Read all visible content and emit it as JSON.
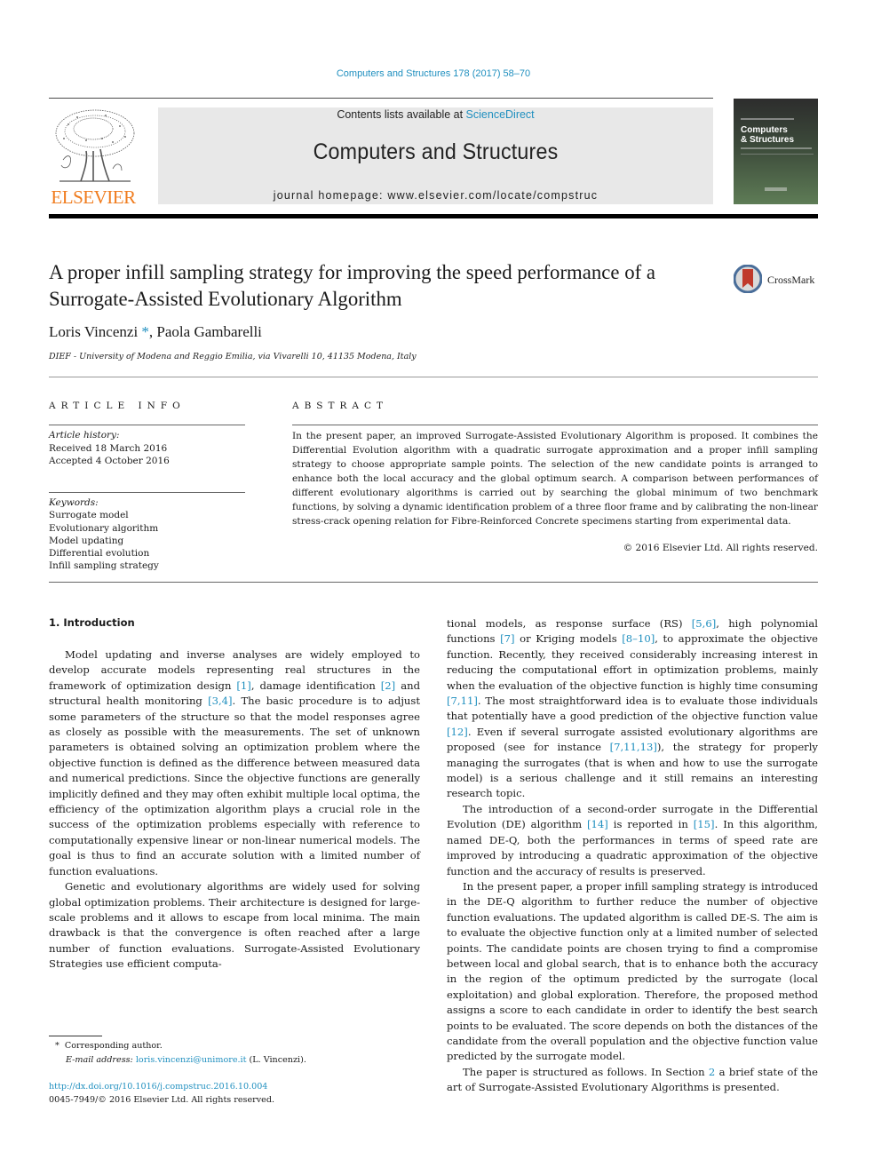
{
  "header": {
    "journal_ref": "Computers and Structures 178 (2017) 58–70",
    "contents_prefix": "Contents lists available at ",
    "contents_link": "ScienceDirect",
    "journal_title": "Computers and Structures",
    "homepage_prefix": "journal homepage: ",
    "homepage_url": "www.elsevier.com/locate/compstruc",
    "publisher_logo_text": "ELSEVIER",
    "cover_title_line1": "Computers",
    "cover_title_line2": "& Structures"
  },
  "article": {
    "title": "A proper infill sampling strategy for improving the speed performance of a Surrogate-Assisted Evolutionary Algorithm",
    "crossmark_label": "CrossMark",
    "authors": [
      {
        "name": "Loris Vincenzi",
        "marker": "*"
      },
      {
        "name": "Paola Gambarelli",
        "marker": ""
      }
    ],
    "author_separator": ", ",
    "affiliation": "DIEF - University of Modena and Reggio Emilia, via Vivarelli 10, 41135 Modena, Italy"
  },
  "article_info": {
    "heading": "ARTICLE INFO",
    "history_label": "Article history:",
    "received": "Received 18 March 2016",
    "accepted": "Accepted 4 October 2016",
    "keywords_label": "Keywords:",
    "keywords": [
      "Surrogate model",
      "Evolutionary algorithm",
      "Model updating",
      "Differential evolution",
      "Infill sampling strategy"
    ]
  },
  "abstract": {
    "heading": "ABSTRACT",
    "text": "In the present paper, an improved Surrogate-Assisted Evolutionary Algorithm is proposed. It combines the Differential Evolution algorithm with a quadratic surrogate approximation and a proper infill sampling strategy to choose appropriate sample points. The selection of the new candidate points is arranged to enhance both the local accuracy and the global optimum search. A comparison between performances of different evolutionary algorithms is carried out by searching the global minimum of two benchmark functions, by solving a dynamic identification problem of a three floor frame and by calibrating the non-linear stress-crack opening relation for Fibre-Reinforced Concrete specimens starting from experimental data.",
    "copyright": "© 2016 Elsevier Ltd. All rights reserved."
  },
  "body": {
    "section_heading": "1. Introduction",
    "paragraphs": [
      {
        "segments": [
          {
            "t": "Model updating and inverse analyses are widely employed to develop accurate models representing real structures in the framework of optimization design "
          },
          {
            "t": "[1]",
            "cite": true
          },
          {
            "t": ", damage identification "
          },
          {
            "t": "[2]",
            "cite": true
          },
          {
            "t": " and structural health monitoring "
          },
          {
            "t": "[3,4]",
            "cite": true
          },
          {
            "t": ". The basic procedure is to adjust some parameters of the structure so that the model responses agree as closely as possible with the measurements. The set of unknown parameters is obtained solving an optimization problem where the objective function is defined as the difference between measured data and numerical predictions. Since the objective functions are generally implicitly defined and they may often exhibit multiple local optima, the efficiency of the optimization algorithm plays a crucial role in the success of the optimization problems especially with reference to computationally expensive linear or non-linear numerical models. The goal is thus to find an accurate solution with a limited number of function evaluations."
          }
        ]
      },
      {
        "segments": [
          {
            "t": "Genetic and evolutionary algorithms are widely used for solving global optimization problems. Their architecture is designed for large-scale problems and it allows to escape from local minima. The main drawback is that the convergence is often reached after a large number of function evaluations. Surrogate-Assisted Evolutionary Strategies use efficient computational models, as response surface (RS) "
          },
          {
            "t": "[5,6]",
            "cite": true
          },
          {
            "t": ", high polynomial functions "
          },
          {
            "t": "[7]",
            "cite": true
          },
          {
            "t": " or Kriging models "
          },
          {
            "t": "[8–10]",
            "cite": true
          },
          {
            "t": ", to approximate the objective function. Recently, they received considerably increasing interest in reducing the computational effort in optimization problems, mainly when the evaluation of the objective function is highly time consuming "
          },
          {
            "t": "[7,11]",
            "cite": true
          },
          {
            "t": ". The most straightforward idea is to evaluate those individuals that potentially have a good prediction of the objective function value "
          },
          {
            "t": "[12]",
            "cite": true
          },
          {
            "t": ". Even if several surrogate assisted evolutionary algorithms are proposed (see for instance "
          },
          {
            "t": "[7,11,13]",
            "cite": true
          },
          {
            "t": "), the strategy for properly managing the surrogates (that is when and how to use the surrogate model) is a serious challenge and it still remains an interesting research topic."
          }
        ]
      },
      {
        "segments": [
          {
            "t": "The introduction of a second-order surrogate in the Differential Evolution (DE) algorithm "
          },
          {
            "t": "[14]",
            "cite": true
          },
          {
            "t": " is reported in "
          },
          {
            "t": "[15]",
            "cite": true
          },
          {
            "t": ". In this algorithm, named DE-Q, both the performances in terms of speed rate are improved by introducing a quadratic approximation of the objective function and the accuracy of results is preserved."
          }
        ]
      },
      {
        "segments": [
          {
            "t": "In the present paper, a proper infill sampling strategy is introduced in the DE-Q algorithm to further reduce the number of objective function evaluations. The updated algorithm is called DE-S. The aim is to evaluate the objective function only at a limited number of selected points. The candidate points are chosen trying to find a compromise between local and global search, that is to enhance both the accuracy in the region of the optimum predicted by the surrogate (local exploitation) and global exploration. Therefore, the proposed method assigns a score to each candidate in order to identify the best search points to be evaluated. The score depends on both the distances of the candidate from the overall population and the objective function value predicted by the surrogate model."
          }
        ]
      },
      {
        "segments": [
          {
            "t": "The paper is structured as follows. In Section "
          },
          {
            "t": "2",
            "cite": true
          },
          {
            "t": " a brief state of the art of Surrogate-Assisted Evolutionary Algorithms is presented."
          }
        ]
      }
    ]
  },
  "footnote": {
    "marker": "*",
    "corresponding": "Corresponding author.",
    "email_label": "E-mail address:",
    "email": "loris.vincenzi@unimore.it",
    "email_suffix": " (L. Vincenzi).",
    "doi": "http://dx.doi.org/10.1016/j.compstruc.2016.10.004",
    "issn_line": "0045-7949/© 2016 Elsevier Ltd. All rights reserved."
  },
  "colors": {
    "link": "#1f8fbf",
    "elsevier_orange": "#f07c1e",
    "header_box": "#e8e8e8",
    "crossmark_red": "#c0392b"
  }
}
